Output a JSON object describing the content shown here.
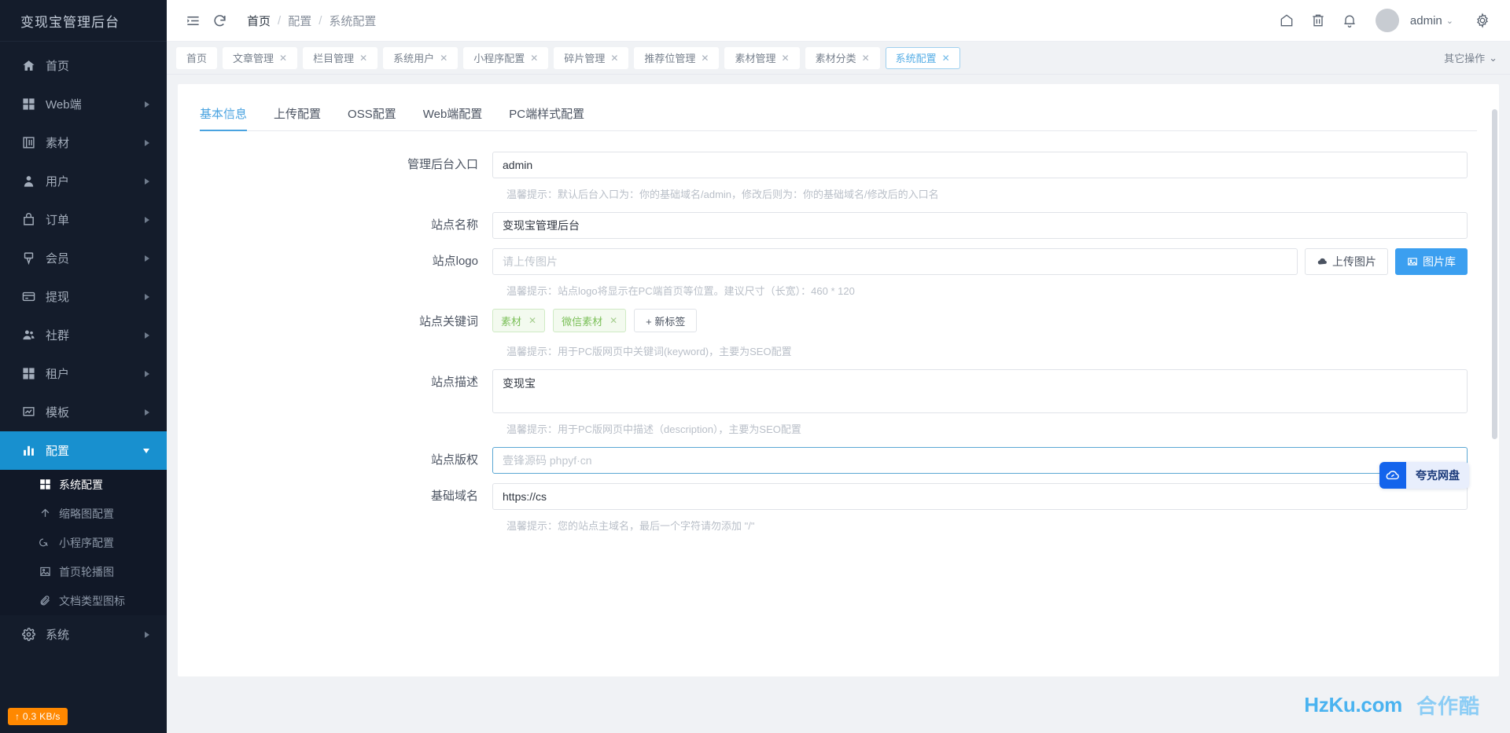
{
  "sidebar": {
    "title": "变现宝管理后台",
    "items": [
      {
        "label": "首页",
        "icon": "home-icon",
        "arrow": false,
        "active": false
      },
      {
        "label": "Web端",
        "icon": "grid-icon",
        "arrow": true,
        "active": false
      },
      {
        "label": "素材",
        "icon": "book-icon",
        "arrow": true,
        "active": false
      },
      {
        "label": "用户",
        "icon": "user-icon",
        "arrow": true,
        "active": false
      },
      {
        "label": "订单",
        "icon": "bag-icon",
        "arrow": true,
        "active": false
      },
      {
        "label": "会员",
        "icon": "medal-icon",
        "arrow": true,
        "active": false
      },
      {
        "label": "提现",
        "icon": "card-icon",
        "arrow": true,
        "active": false
      },
      {
        "label": "社群",
        "icon": "users-icon",
        "arrow": true,
        "active": false
      },
      {
        "label": "租户",
        "icon": "grid-icon",
        "arrow": true,
        "active": false
      },
      {
        "label": "模板",
        "icon": "template-icon",
        "arrow": true,
        "active": false
      },
      {
        "label": "配置",
        "icon": "chart-icon",
        "arrow": true,
        "active": true
      }
    ],
    "sub_items": [
      {
        "label": "系统配置",
        "icon": "grid-small-icon",
        "active": true
      },
      {
        "label": "缩略图配置",
        "icon": "upload-icon",
        "active": false
      },
      {
        "label": "小程序配置",
        "icon": "miniapp-icon",
        "active": false
      },
      {
        "label": "首页轮播图",
        "icon": "image-icon",
        "active": false
      },
      {
        "label": "文档类型图标",
        "icon": "paperclip-icon",
        "active": false
      }
    ],
    "tail_items": [
      {
        "label": "系统",
        "icon": "settings-icon",
        "arrow": true,
        "active": false
      }
    ],
    "netspeed": "↑ 0.3 KB/s"
  },
  "topbar": {
    "menu_icon": "collapse-menu-icon",
    "refresh_icon": "refresh-icon",
    "breadcrumb": [
      "首页",
      "配置",
      "系统配置"
    ],
    "separator": "/",
    "right_icons": [
      "home-icon",
      "trash-icon",
      "bell-icon"
    ],
    "username": "admin",
    "chevron": "⌄",
    "gear_icon": "gear-icon"
  },
  "tabstrip": {
    "tabs": [
      {
        "label": "首页",
        "closable": false,
        "active": false
      },
      {
        "label": "文章管理",
        "closable": true,
        "active": false
      },
      {
        "label": "栏目管理",
        "closable": true,
        "active": false
      },
      {
        "label": "系统用户",
        "closable": true,
        "active": false
      },
      {
        "label": "小程序配置",
        "closable": true,
        "active": false
      },
      {
        "label": "碎片管理",
        "closable": true,
        "active": false
      },
      {
        "label": "推荐位管理",
        "closable": true,
        "active": false
      },
      {
        "label": "素材管理",
        "closable": true,
        "active": false
      },
      {
        "label": "素材分类",
        "closable": true,
        "active": false
      },
      {
        "label": "系统配置",
        "closable": true,
        "active": true
      }
    ],
    "close_glyph": "✕",
    "other_actions": "其它操作",
    "other_actions_chevron": "⌄"
  },
  "inner_tabs": [
    {
      "label": "基本信息",
      "active": true
    },
    {
      "label": "上传配置",
      "active": false
    },
    {
      "label": "OSS配置",
      "active": false
    },
    {
      "label": "Web端配置",
      "active": false
    },
    {
      "label": "PC端样式配置",
      "active": false
    }
  ],
  "form": {
    "admin_entry": {
      "label": "管理后台入口",
      "value": "admin",
      "placeholder": "",
      "hint": "温馨提示：默认后台入口为：你的基础域名/admin，修改后则为：你的基础域名/修改后的入口名"
    },
    "site_name": {
      "label": "站点名称",
      "value": "变现宝管理后台",
      "placeholder": ""
    },
    "site_logo": {
      "label": "站点logo",
      "value": "",
      "placeholder": "请上传图片",
      "upload_button": "上传图片",
      "upload_icon": "cloud-upload-icon",
      "library_button": "图片库",
      "library_icon": "image-icon",
      "hint": "温馨提示：站点logo将显示在PC端首页等位置。建议尺寸（长宽）：460 * 120"
    },
    "site_keywords": {
      "label": "站点关键词",
      "tags": [
        "素材",
        "微信素材"
      ],
      "tag_close_glyph": "✕",
      "add_tag_label": "+ 新标签",
      "hint": "温馨提示：用于PC版网页中关键词(keyword)，主要为SEO配置"
    },
    "site_description": {
      "label": "站点描述",
      "value": "变现宝",
      "placeholder": "",
      "hint": "温馨提示：用于PC版网页中描述（description），主要为SEO配置"
    },
    "site_copyright": {
      "label": "站点版权",
      "value": "",
      "placeholder": "壹锋源码 phpyf·cn",
      "focused": true
    },
    "base_domain": {
      "label": "基础域名",
      "value": "https://cs",
      "placeholder": "",
      "hint": "温馨提示：您的站点主域名，最后一个字符请勿添加 \"/\""
    }
  },
  "float_widget": {
    "label": "夸克网盘",
    "icon": "quark-cloud-icon"
  },
  "watermark": {
    "primary": "HzKu.com",
    "secondary": "合作酷"
  },
  "colors": {
    "sidebar_bg": "#141c2b",
    "accent": "#1890cf",
    "primary_button": "#3b9ff0",
    "tag_green": "#7cc05a",
    "watermark_blue": "#4ab3f0"
  }
}
